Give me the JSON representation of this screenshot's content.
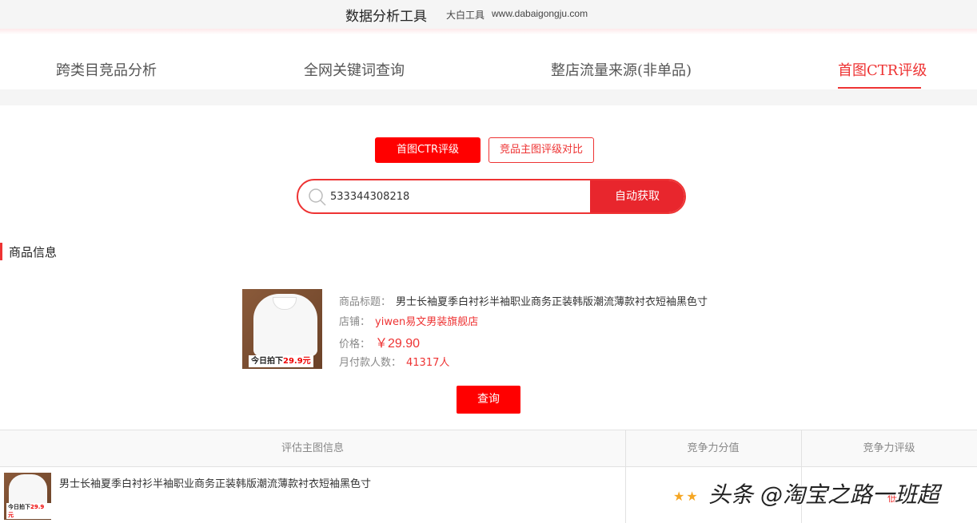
{
  "header": {
    "title": "数据分析工具",
    "brand": "大白工具",
    "site": "www.dabaigongju.com"
  },
  "tabs": [
    {
      "label": "跨类目竞品分析",
      "active": false
    },
    {
      "label": "全网关键词查询",
      "active": false
    },
    {
      "label": "整店流量来源(非单品)",
      "active": false
    },
    {
      "label": "首图CTR评级",
      "active": true
    }
  ],
  "modes": {
    "primary": "首图CTR评级",
    "secondary": "竞品主图评级对比"
  },
  "search": {
    "value": "533344308218",
    "button": "自动获取"
  },
  "section": {
    "title": "商品信息"
  },
  "product": {
    "thumb_tag_prefix": "今日拍下",
    "thumb_tag_price": "29.9元",
    "title_label": "商品标题：",
    "title": "男士长袖夏季白衬衫半袖职业商务正装韩版潮流薄款衬衣短袖黑色寸",
    "shop_label": "店铺：",
    "shop": "yiwen易文男装旗舰店",
    "price_label": "价格：",
    "price": "￥29.90",
    "buyers_label": "月付款人数：",
    "buyers": "41317人"
  },
  "query_button": "查询",
  "table": {
    "headers": [
      "评估主图信息",
      "竞争力分值",
      "竞争力评级"
    ],
    "rows": [
      {
        "thumb_tag_prefix": "今日拍下",
        "thumb_tag_price": "29.9元",
        "title": "男士长袖夏季白衬衫半袖职业商务正装韩版潮流薄款衬衣短袖黑色寸",
        "stars": "★★",
        "grade": "低"
      }
    ]
  },
  "watermark": "头条 @淘宝之路一班超",
  "colors": {
    "accent": "#ee3333",
    "button_red": "#ff0000"
  }
}
